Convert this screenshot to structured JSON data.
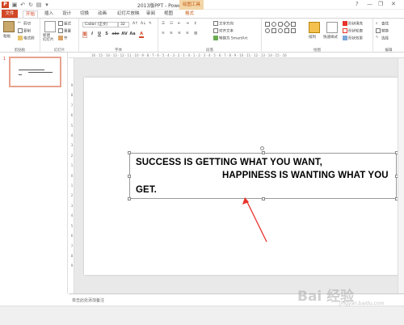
{
  "window": {
    "title": "2013版PPT - PowerPoint",
    "context_tab_title": "绘图工具",
    "controls": [
      "?",
      "—",
      "❐",
      "✕"
    ]
  },
  "tabs": {
    "file": "文件",
    "items": [
      "开始",
      "插入",
      "设计",
      "切换",
      "动画",
      "幻灯片放映",
      "审阅",
      "视图",
      "格式"
    ],
    "active": "开始"
  },
  "ribbon": {
    "clipboard": {
      "paste": "粘贴",
      "cut": "剪切",
      "copy": "复制",
      "format_painter": "格式刷",
      "label": "剪贴板"
    },
    "slides": {
      "new_slide": "新建\n幻灯片",
      "layout": "版式",
      "reset": "重置",
      "section": "节",
      "label": "幻灯片"
    },
    "font": {
      "font_name": "Calibri (正文)",
      "font_size": "32",
      "label": "字体",
      "format_buttons": [
        "B",
        "I",
        "U",
        "S",
        "abc",
        "AV",
        "Aa",
        "A"
      ]
    },
    "paragraph": {
      "text_direction": "文字方向",
      "align_text": "对齐文本",
      "smartart": "转换为 SmartArt",
      "label": "段落"
    },
    "drawing": {
      "arrange": "排列",
      "quick_styles": "快速样式",
      "shape_fill": "形状填充",
      "shape_outline": "形状轮廓",
      "shape_effects": "形状效果",
      "label": "绘图"
    },
    "editing": {
      "find": "查找",
      "replace": "替换",
      "select": "选择",
      "label": "编辑"
    }
  },
  "slides_panel": {
    "slide_number": "1"
  },
  "rulers": {
    "horizontal": "16 · 15 · 14 · 13 · 12 · 11 · 10 · 9 · 8 · 7 · 6 · 5 · 4 · 3 · 2 · 1 · 0 · 1 · 2 · 3 · 4 · 5 · 6 · 7 · 8 · 9 · 10 · 11 · 12 · 13 · 14 · 15 · 16",
    "vertical": [
      "9",
      "8",
      "7",
      "6",
      "5",
      "4",
      "3",
      "2",
      "1",
      "0",
      "1",
      "2",
      "3",
      "4",
      "5",
      "6",
      "7",
      "8",
      "9"
    ]
  },
  "slide": {
    "line1": "SUCCESS IS GETTING WHAT YOU WANT,",
    "line2": "HAPPINESS IS WANTING WHAT YOU",
    "line3": "GET.",
    "arrow_color": "#e8322a"
  },
  "notes": {
    "placeholder": "单击此处添加备注"
  },
  "watermark": {
    "text": "Bai 经验",
    "sub": "jingyan.baidu.com"
  },
  "colors": {
    "accent": "#d24726",
    "context": "#f3d5a6"
  }
}
